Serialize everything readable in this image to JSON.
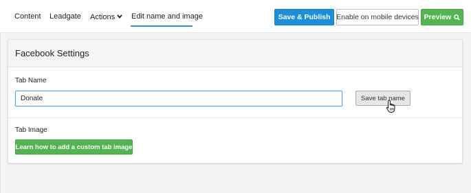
{
  "nav": {
    "tabs": [
      {
        "label": "Content"
      },
      {
        "label": "Leadgate"
      },
      {
        "label": "Actions"
      },
      {
        "label": "Edit name and image"
      }
    ],
    "active_tab": "Edit name and image"
  },
  "toolbar": {
    "save_publish_label": "Save & Publish",
    "mobile_label": "Enable on mobile devices",
    "preview_label": "Preview",
    "preview_icon": "search-icon"
  },
  "card": {
    "title": "Facebook Settings",
    "tab_name_label": "Tab Name",
    "tab_name_value": "Donate",
    "save_tab_name_label": "Save tab name",
    "tab_image_label": "Tab Image",
    "learn_button_label": "Learn how to add a custom tab image"
  },
  "colors": {
    "primary": "#1a8fdb",
    "success": "#52b552",
    "active_underline": "#2e8fd6"
  }
}
